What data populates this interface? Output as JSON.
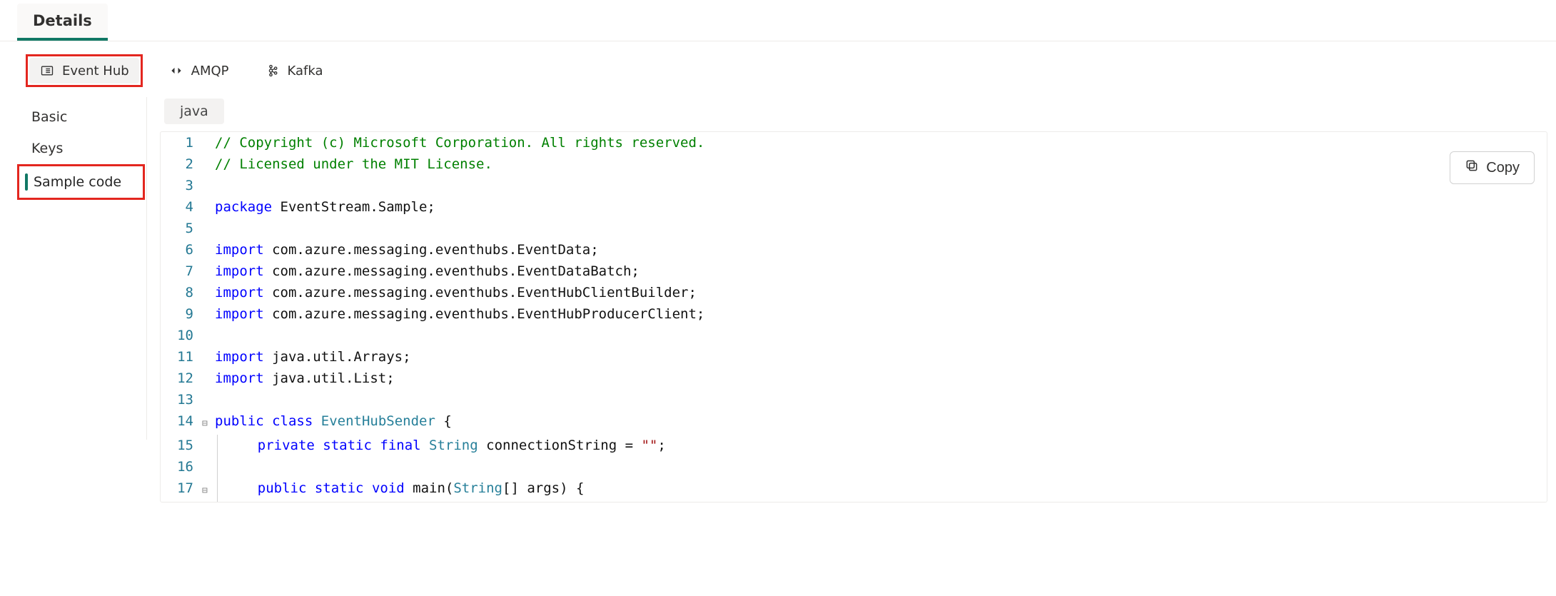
{
  "tabs": {
    "details": "Details"
  },
  "protocols": {
    "eventhub": "Event Hub",
    "amqp": "AMQP",
    "kafka": "Kafka"
  },
  "sidebar": {
    "basic": "Basic",
    "keys": "Keys",
    "sample": "Sample code"
  },
  "language": "java",
  "copy_label": "Copy",
  "code": {
    "lines": [
      {
        "n": 1,
        "fold": "",
        "tokens": [
          [
            "comment",
            "// Copyright (c) Microsoft Corporation. All rights reserved."
          ]
        ]
      },
      {
        "n": 2,
        "fold": "",
        "tokens": [
          [
            "comment",
            "// Licensed under the MIT License."
          ]
        ]
      },
      {
        "n": 3,
        "fold": "",
        "tokens": []
      },
      {
        "n": 4,
        "fold": "",
        "tokens": [
          [
            "kw",
            "package"
          ],
          [
            "text",
            " EventStream.Sample;"
          ]
        ]
      },
      {
        "n": 5,
        "fold": "",
        "tokens": []
      },
      {
        "n": 6,
        "fold": "",
        "tokens": [
          [
            "kw",
            "import"
          ],
          [
            "text",
            " com.azure.messaging.eventhubs.EventData;"
          ]
        ]
      },
      {
        "n": 7,
        "fold": "",
        "tokens": [
          [
            "kw",
            "import"
          ],
          [
            "text",
            " com.azure.messaging.eventhubs.EventDataBatch;"
          ]
        ]
      },
      {
        "n": 8,
        "fold": "",
        "tokens": [
          [
            "kw",
            "import"
          ],
          [
            "text",
            " com.azure.messaging.eventhubs.EventHubClientBuilder;"
          ]
        ]
      },
      {
        "n": 9,
        "fold": "",
        "tokens": [
          [
            "kw",
            "import"
          ],
          [
            "text",
            " com.azure.messaging.eventhubs.EventHubProducerClient;"
          ]
        ]
      },
      {
        "n": 10,
        "fold": "",
        "tokens": []
      },
      {
        "n": 11,
        "fold": "",
        "tokens": [
          [
            "kw",
            "import"
          ],
          [
            "text",
            " java.util.Arrays;"
          ]
        ]
      },
      {
        "n": 12,
        "fold": "",
        "tokens": [
          [
            "kw",
            "import"
          ],
          [
            "text",
            " java.util.List;"
          ]
        ]
      },
      {
        "n": 13,
        "fold": "",
        "tokens": []
      },
      {
        "n": 14,
        "fold": "⊟",
        "tokens": [
          [
            "kw",
            "public"
          ],
          [
            "text",
            " "
          ],
          [
            "kw",
            "class"
          ],
          [
            "text",
            " "
          ],
          [
            "type",
            "EventHubSender"
          ],
          [
            "text",
            " {"
          ]
        ]
      },
      {
        "n": 15,
        "fold": "",
        "indent": true,
        "tokens": [
          [
            "text",
            "    "
          ],
          [
            "kw",
            "private"
          ],
          [
            "text",
            " "
          ],
          [
            "kw",
            "static"
          ],
          [
            "text",
            " "
          ],
          [
            "kw",
            "final"
          ],
          [
            "text",
            " "
          ],
          [
            "type",
            "String"
          ],
          [
            "text",
            " connectionString = "
          ],
          [
            "str",
            "\"\""
          ],
          [
            "text",
            ";"
          ]
        ]
      },
      {
        "n": 16,
        "fold": "",
        "indent": true,
        "tokens": []
      },
      {
        "n": 17,
        "fold": "⊟",
        "indent": true,
        "tokens": [
          [
            "text",
            "    "
          ],
          [
            "kw",
            "public"
          ],
          [
            "text",
            " "
          ],
          [
            "kw",
            "static"
          ],
          [
            "text",
            " "
          ],
          [
            "kw",
            "void"
          ],
          [
            "text",
            " main("
          ],
          [
            "type",
            "String"
          ],
          [
            "text",
            "[] args) {"
          ]
        ]
      }
    ]
  }
}
